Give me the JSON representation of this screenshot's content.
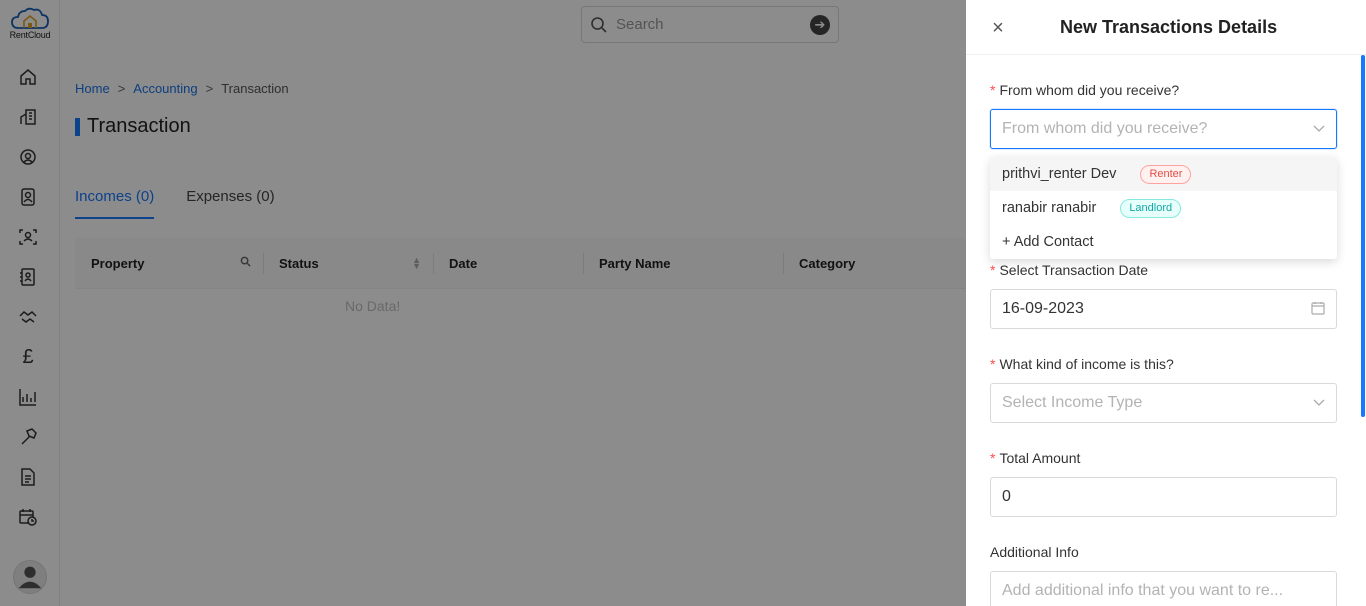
{
  "app": {
    "logo_text": "RentCloud"
  },
  "sidebar": {
    "icons": [
      "home-icon",
      "properties-icon",
      "location-icon",
      "contacts-icon",
      "tenant-scan-icon",
      "address-book-icon",
      "handshake-icon",
      "pound-icon",
      "reports-chart-icon",
      "tools-hammer-icon",
      "document-icon",
      "calendar-clock-icon"
    ]
  },
  "topbar": {
    "search_placeholder": "Search"
  },
  "breadcrumb": {
    "home": "Home",
    "sep": ">",
    "accounting": "Accounting",
    "current": "Transaction"
  },
  "page": {
    "title": "Transaction"
  },
  "tabs": [
    {
      "label": "Incomes (0)",
      "active": true
    },
    {
      "label": "Expenses (0)",
      "active": false
    }
  ],
  "table": {
    "columns": [
      "Property",
      "Status",
      "Date",
      "Party Name",
      "Category"
    ],
    "empty_text": "No Data!"
  },
  "drawer": {
    "close": "×",
    "title": "New Transactions Details",
    "required_mark": "*",
    "from_label": "From whom did you receive?",
    "from_placeholder": "From whom did you receive?",
    "dropdown_options": [
      {
        "name": "prithvi_renter Dev",
        "tag": "Renter"
      },
      {
        "name": "ranabir ranabir",
        "tag": "Landlord"
      }
    ],
    "add_contact": "+ Add Contact",
    "date_label": "Select Transaction Date",
    "date_value": "16-09-2023",
    "income_label": "What kind of income is this?",
    "income_placeholder": "Select Income Type",
    "amount_label": "Total Amount",
    "amount_value": "0",
    "info_label": "Additional Info",
    "info_placeholder": "Add additional info that you want to re..."
  },
  "colors": {
    "accent": "#1677ff",
    "required": "#ff4d4f",
    "renter_tag": "#e04e48",
    "landlord_tag": "#13a8a8"
  }
}
